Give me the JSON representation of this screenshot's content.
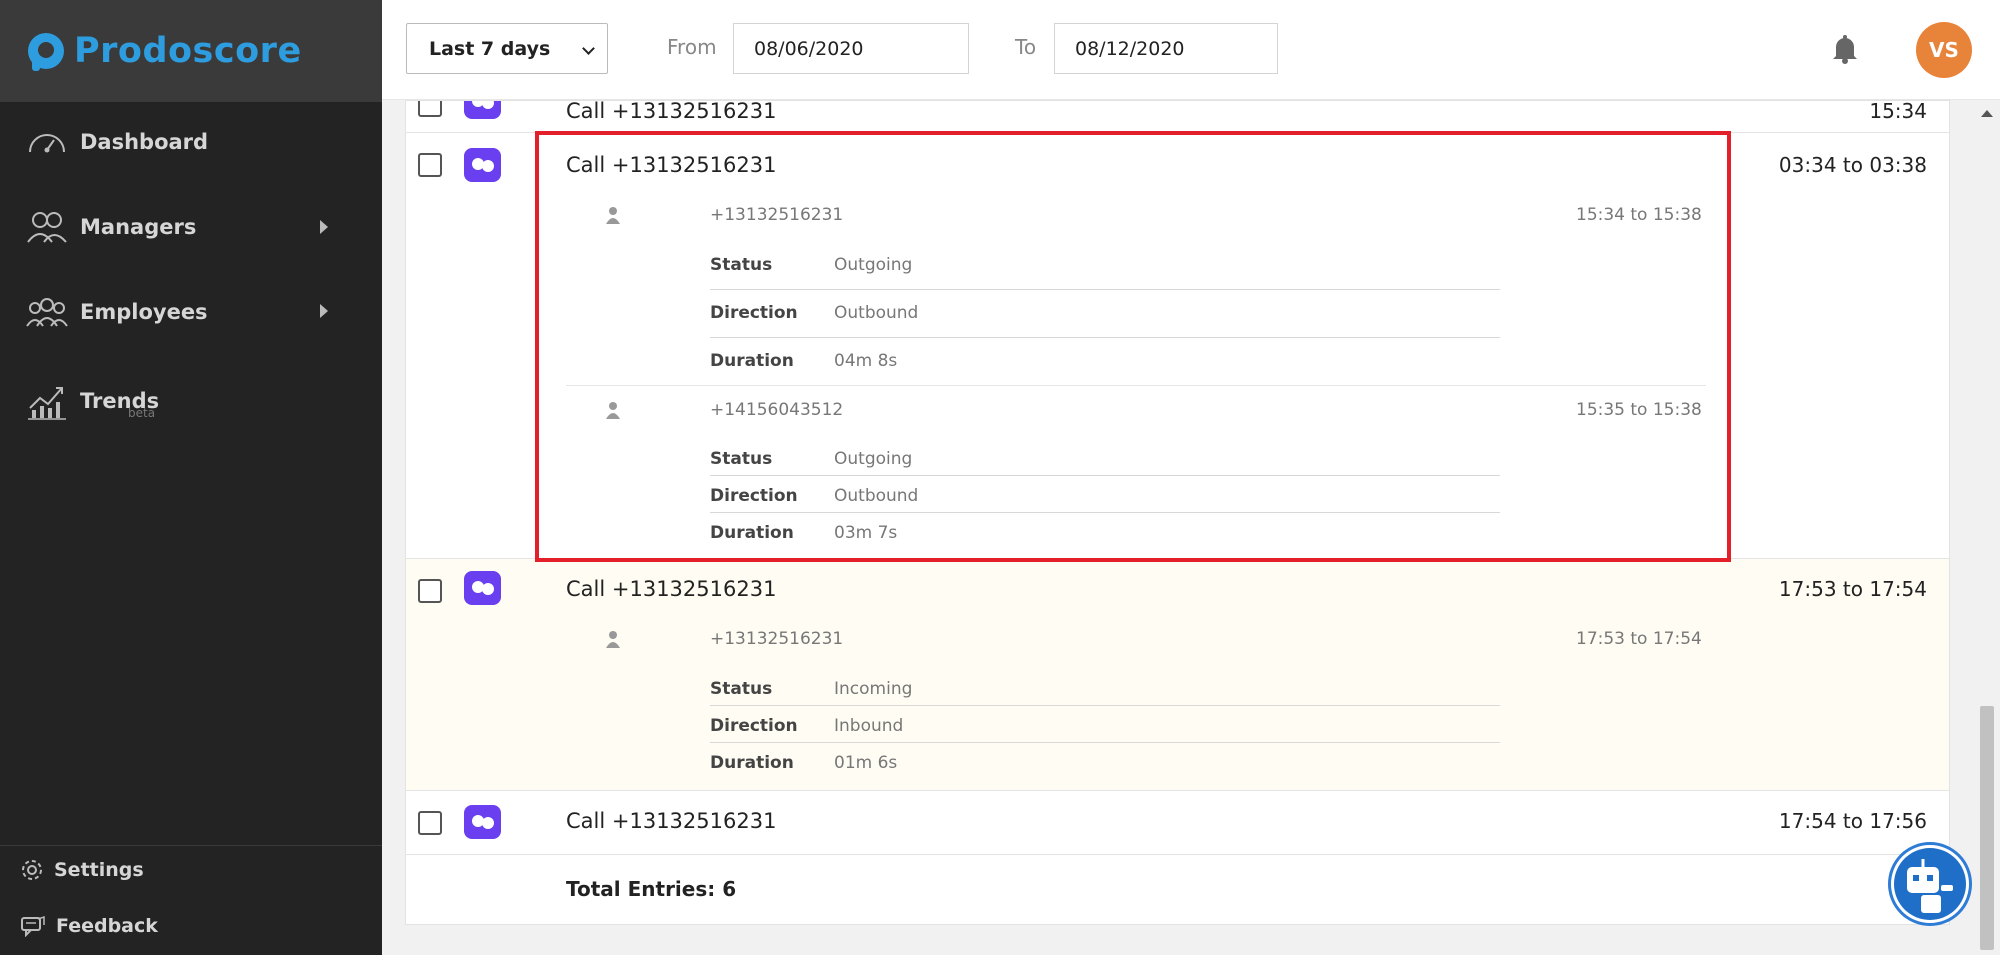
{
  "brand": {
    "name": "Prodoscore",
    "color": "#2e9de0"
  },
  "sidebar": {
    "items": [
      {
        "label": "Dashboard",
        "icon": "speedometer-icon"
      },
      {
        "label": "Managers",
        "icon": "managers-icon"
      },
      {
        "label": "Employees",
        "icon": "employees-icon"
      },
      {
        "label": "Trends",
        "icon": "trends-icon",
        "badge": "beta"
      }
    ],
    "footer": [
      {
        "label": "Settings",
        "icon": "gear-icon"
      },
      {
        "label": "Feedback",
        "icon": "feedback-icon"
      }
    ]
  },
  "header": {
    "range_select": "Last 7 days",
    "from_label": "From",
    "from_value": "08/06/2020",
    "to_label": "To",
    "to_value": "08/12/2020",
    "avatar_initials": "VS",
    "avatar_color": "#e8833a"
  },
  "calls": {
    "partial": {
      "title": "Call +13132516231",
      "time": "15:34"
    },
    "entry1": {
      "title": "Call +13132516231",
      "time": "03:34 to 03:38",
      "legs": [
        {
          "number": "+13132516231",
          "time": "15:34 to 15:38",
          "status": "Outgoing",
          "direction": "Outbound",
          "duration": "04m 8s"
        },
        {
          "number": "+14156043512",
          "time": "15:35 to 15:38",
          "status": "Outgoing",
          "direction": "Outbound",
          "duration": "03m 7s"
        }
      ]
    },
    "entry2": {
      "title": "Call +13132516231",
      "time": "17:53 to 17:54",
      "legs": [
        {
          "number": "+13132516231",
          "time": "17:53 to 17:54",
          "status": "Incoming",
          "direction": "Inbound",
          "duration": "01m 6s"
        }
      ]
    },
    "entry3": {
      "title": "Call +13132516231",
      "time": "17:54 to 17:56"
    },
    "labels": {
      "status": "Status",
      "direction": "Direction",
      "duration": "Duration"
    },
    "total": "Total Entries: 6"
  },
  "colors": {
    "app_badge": "#6a3ff0",
    "highlight_border": "#e3202a"
  }
}
